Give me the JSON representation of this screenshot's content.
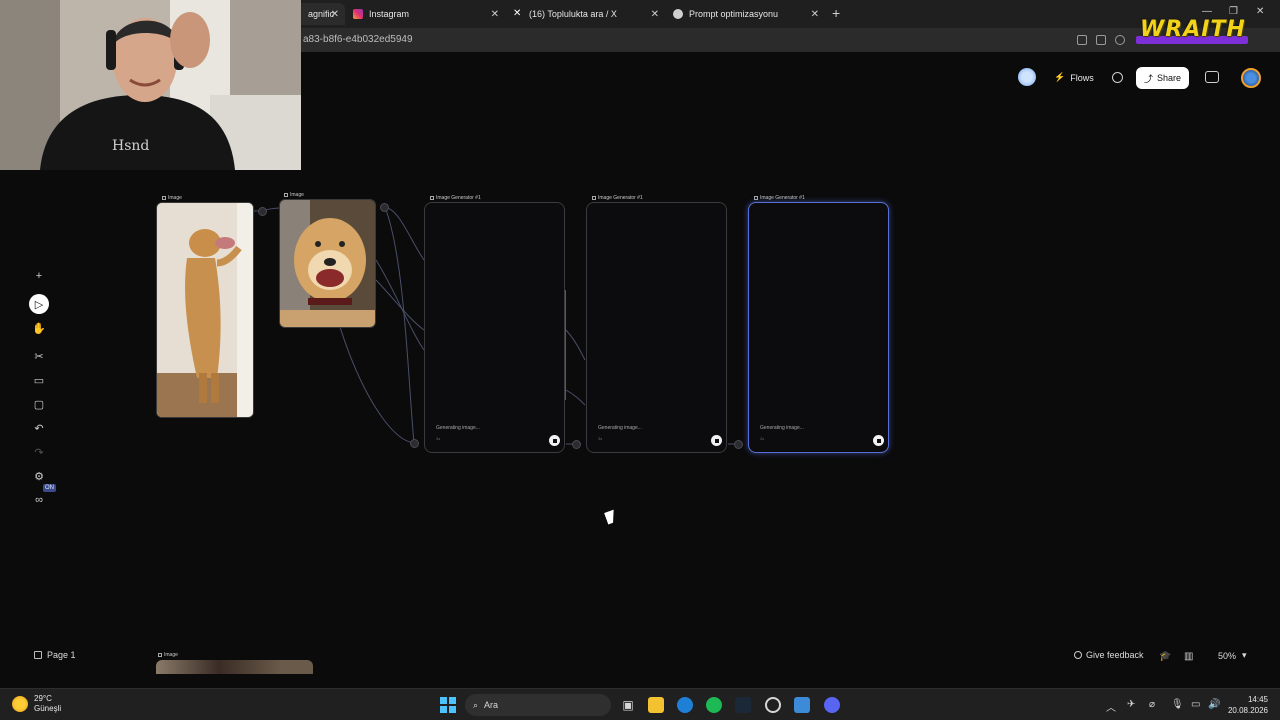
{
  "browser": {
    "tabs": [
      {
        "label": "Magnific",
        "active": true,
        "favicon_color": "#ffffff"
      },
      {
        "label": "Instagram",
        "active": false,
        "favicon_color": "#e1306c"
      },
      {
        "label": "(16) Toplulukta ara / X",
        "active": false,
        "favicon_color": "#000000"
      },
      {
        "label": "Prompt optimizasyonu",
        "active": false,
        "favicon_color": "#d0d0d0"
      }
    ],
    "tab_first_partial": "agnific",
    "url": "a83-b8f6-e4b032ed5949",
    "overlay_brand": "WRAITH"
  },
  "app": {
    "header": {
      "flows_label": "Flows",
      "share_label": "Share"
    },
    "toolbar": {
      "on_badge": "ON"
    },
    "canvas": {
      "image_nodes": [
        {
          "label": "Image"
        },
        {
          "label": "Image"
        }
      ],
      "generator_nodes": [
        {
          "label": "Image Generator #1",
          "status": "Generating image...",
          "time": "3s"
        },
        {
          "label": "Image Generator #1",
          "status": "Generating image...",
          "time": "3s"
        },
        {
          "label": "Image Generator #1",
          "status": "Generating image...",
          "time": "2s"
        }
      ],
      "bottom_image_label": "Image"
    },
    "footer": {
      "page_label": "Page 1",
      "feedback_label": "Give feedback",
      "zoom": "50%"
    }
  },
  "taskbar": {
    "temperature": "29°C",
    "weather": "Güneşli",
    "search_label": "Ara",
    "time": "14:45",
    "date": "20.08.2026"
  }
}
